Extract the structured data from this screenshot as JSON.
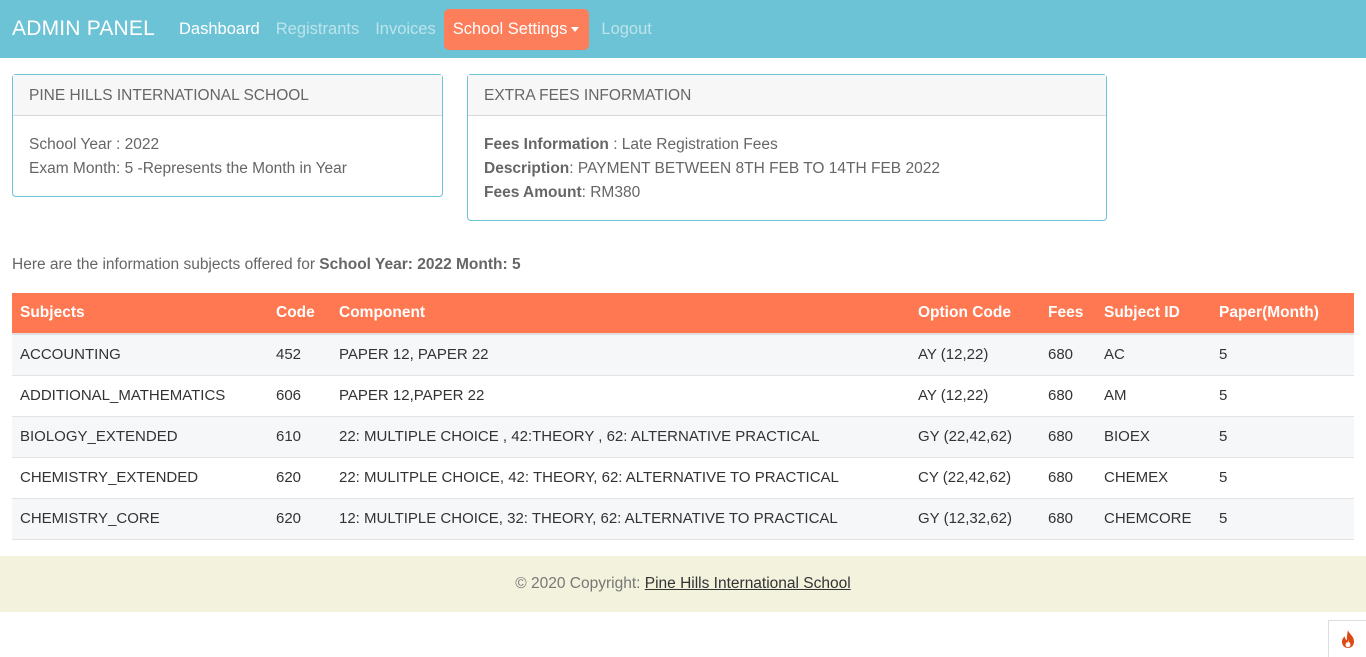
{
  "nav": {
    "brand": "ADMIN PANEL",
    "items": [
      {
        "label": "Dashboard"
      },
      {
        "label": "Registrants"
      },
      {
        "label": "Invoices"
      },
      {
        "label": "School Settings"
      },
      {
        "label": "Logout"
      }
    ]
  },
  "school_card": {
    "header": "PINE HILLS INTERNATIONAL SCHOOL",
    "year_line": "School Year : 2022",
    "month_line": "Exam Month: 5 -Represents the Month in Year"
  },
  "fees_card": {
    "header": "EXTRA FEES INFORMATION",
    "info_label": "Fees Information",
    "info_value": " : Late Registration Fees",
    "desc_label": "Description",
    "desc_value": ": PAYMENT BETWEEN 8TH FEB TO 14TH FEB 2022",
    "amount_label": "Fees Amount",
    "amount_value": ": RM380"
  },
  "intro": {
    "text": "Here are the information subjects offered for ",
    "bold": "School Year: 2022 Month: 5"
  },
  "table": {
    "headers": [
      "Subjects",
      "Code",
      "Component",
      "Option Code",
      "Fees",
      "Subject ID",
      "Paper(Month)"
    ],
    "rows": [
      [
        "ACCOUNTING",
        "452",
        "PAPER 12, PAPER 22",
        "AY (12,22)",
        "680",
        "AC",
        "5"
      ],
      [
        "ADDITIONAL_MATHEMATICS",
        "606",
        "PAPER 12,PAPER 22",
        "AY (12,22)",
        "680",
        "AM",
        "5"
      ],
      [
        "BIOLOGY_EXTENDED",
        "610",
        "22: MULTIPLE CHOICE , 42:THEORY , 62: ALTERNATIVE PRACTICAL",
        "GY (22,42,62)",
        "680",
        "BIOEX",
        "5"
      ],
      [
        "CHEMISTRY_EXTENDED",
        "620",
        "22: MULITPLE CHOICE, 42: THEORY, 62: ALTERNATIVE TO PRACTICAL",
        "CY (22,42,62)",
        "680",
        "CHEMEX",
        "5"
      ],
      [
        "CHEMISTRY_CORE",
        "620",
        "12: MULTIPLE CHOICE, 32: THEORY, 62: ALTERNATIVE TO PRACTICAL",
        "GY (12,32,62)",
        "680",
        "CHEMCORE",
        "5"
      ]
    ]
  },
  "footer": {
    "prefix": "© 2020 Copyright: ",
    "link": "Pine Hills International School"
  },
  "colors": {
    "navbar": "#6cc3d5",
    "accent": "#fd7e5b",
    "table_header": "#ff7851",
    "footer": "#f3f2dd"
  },
  "icons": {
    "corner_button": "flame-icon"
  }
}
